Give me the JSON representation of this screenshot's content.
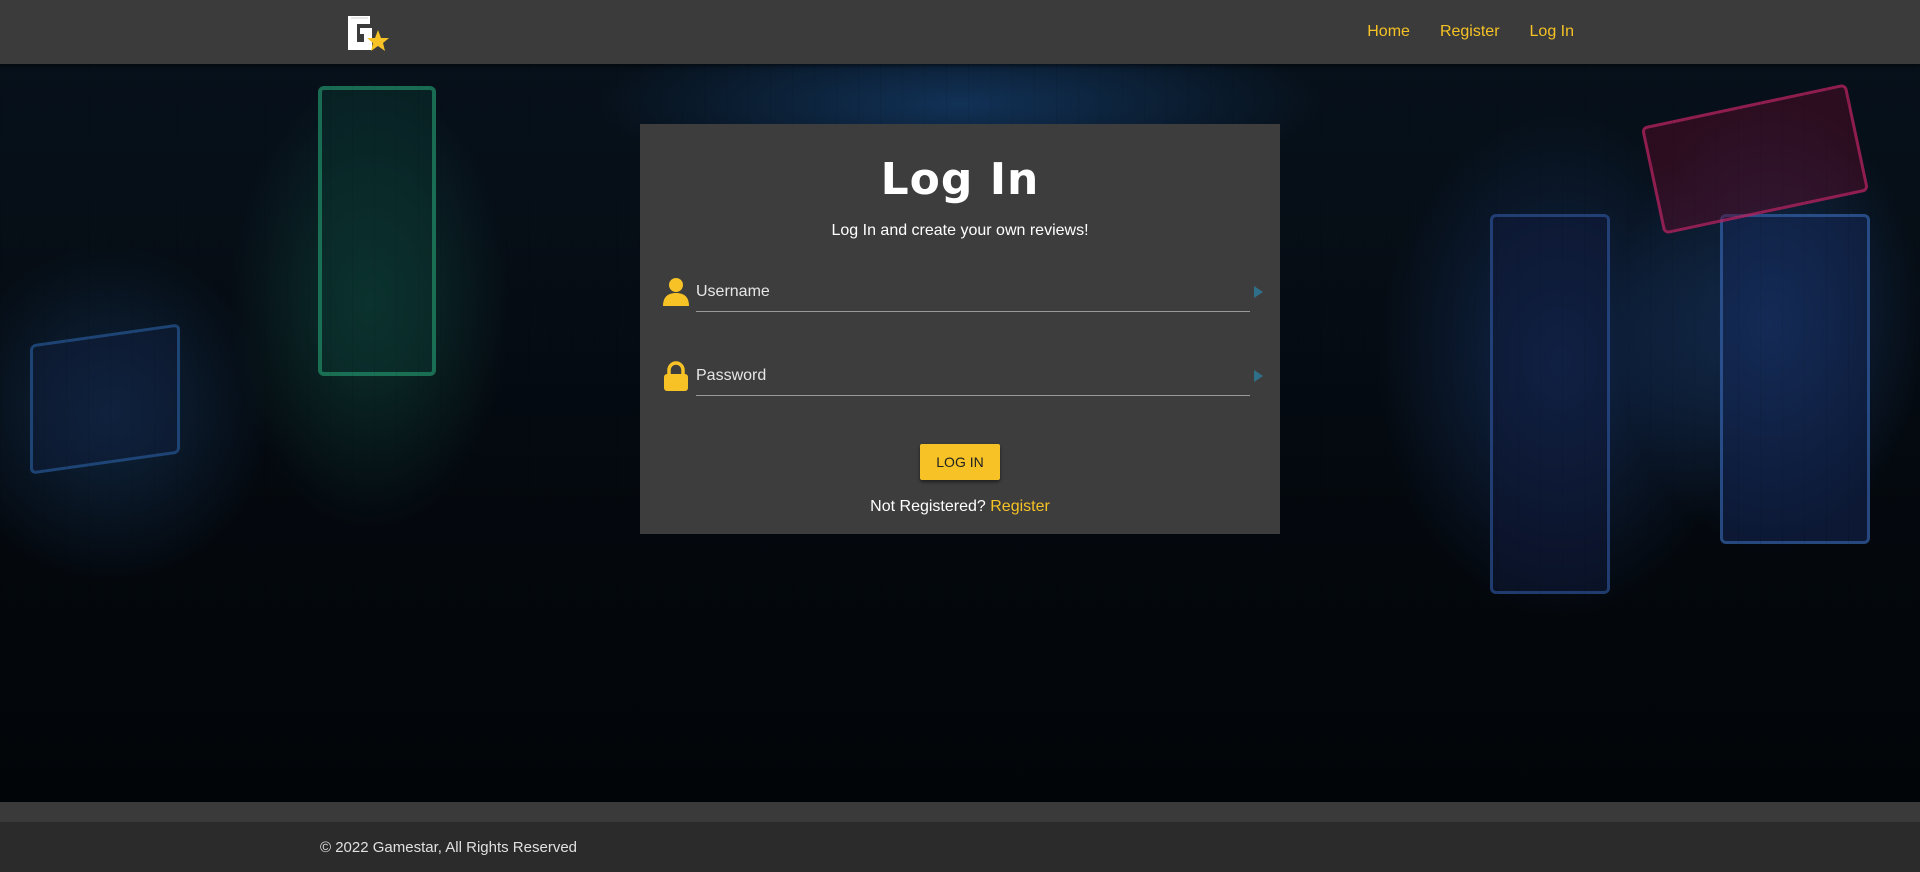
{
  "nav": {
    "logo_icon": "gamestar-logo-icon",
    "links": [
      {
        "label": "Home"
      },
      {
        "label": "Register"
      },
      {
        "label": "Log In"
      }
    ]
  },
  "login": {
    "title": "Log In",
    "subtitle": "Log In and create your own reviews!",
    "username": {
      "placeholder": "Username",
      "value": "",
      "icon": "user-icon"
    },
    "password": {
      "placeholder": "Password",
      "value": "",
      "icon": "lock-icon"
    },
    "button_label": "LOG IN",
    "register_prompt": "Not Registered?",
    "register_link": "Register"
  },
  "footer": {
    "text": "© 2022 Gamestar, All Rights Reserved"
  },
  "colors": {
    "accent": "#f6c225",
    "navbar": "#3b3b3b",
    "card": "#3d3d3d",
    "footer": "#2b2b2b"
  }
}
